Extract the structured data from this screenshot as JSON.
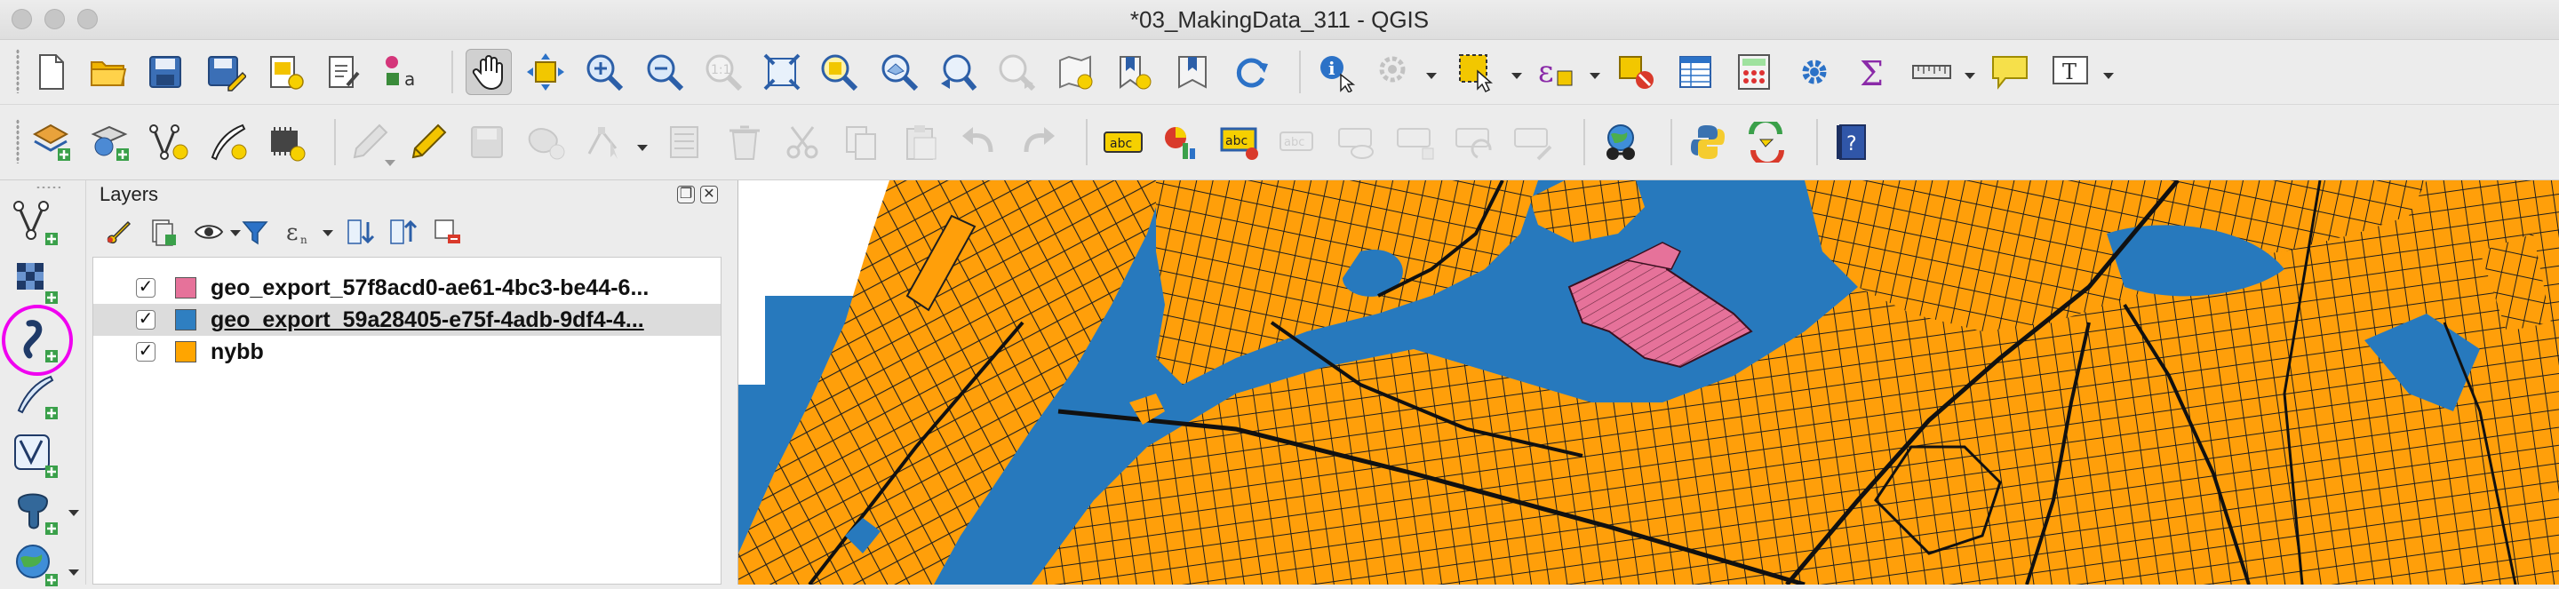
{
  "window": {
    "title": "*03_MakingData_311 - QGIS"
  },
  "toolbar_row1": {
    "icons": [
      "new-project-icon",
      "open-project-icon",
      "save-project-icon",
      "save-as-icon",
      "new-print-layout-icon",
      "layout-manager-icon",
      "style-manager-icon",
      "pan-map-icon",
      "pan-to-selection-icon",
      "zoom-in-icon",
      "zoom-out-icon",
      "zoom-native-icon",
      "zoom-full-icon",
      "zoom-to-selection-icon",
      "zoom-to-layer-icon",
      "zoom-last-icon",
      "zoom-next-icon",
      "new-map-view-icon",
      "new-bookmark-icon",
      "show-bookmarks-icon",
      "refresh-icon",
      "identify-icon",
      "action-icon",
      "select-features-icon",
      "select-by-expression-icon",
      "deselect-icon",
      "attribute-table-icon",
      "field-calculator-icon",
      "processing-toolbox-icon",
      "statistics-icon",
      "measure-icon",
      "map-tips-icon",
      "text-annotation-icon"
    ]
  },
  "toolbar_row2": {
    "icons": [
      "add-layer-icon",
      "data-source-manager-icon",
      "new-shapefile-icon",
      "digitize-icon",
      "plugin-icon",
      "toggle-editing-icon",
      "edit-pencil-icon",
      "save-edits-icon",
      "add-feature-icon",
      "vertex-tool-icon",
      "modify-attributes-icon",
      "delete-selected-icon",
      "cut-features-icon",
      "copy-features-icon",
      "paste-features-icon",
      "undo-icon",
      "redo-icon",
      "label-icon",
      "diagram-icon",
      "highlight-labels-icon",
      "pin-labels-icon",
      "show-hide-labels-icon",
      "move-label-icon",
      "rotate-label-icon",
      "change-label-icon",
      "crs-tool-icon",
      "python-console-icon",
      "plugin-reloader-icon",
      "help-icon"
    ]
  },
  "sidebar": {
    "icons": [
      "new-shapefile-layer-icon",
      "new-raster-layer-icon",
      "new-geopackage-layer-icon",
      "new-spatialite-layer-icon",
      "new-virtual-layer-icon",
      "new-postgis-layer-icon",
      "new-web-layer-icon"
    ]
  },
  "layers_panel": {
    "title": "Layers",
    "layers": [
      {
        "name": "geo_export_57f8acd0-ae61-4bc3-be44-6...",
        "color": "#e6729a",
        "checked": true,
        "selected": false
      },
      {
        "name": "geo_export_59a28405-e75f-4adb-9df4-4...",
        "color": "#2f7fc1",
        "checked": true,
        "selected": true
      },
      {
        "name": "nybb",
        "color": "#ffa500",
        "checked": true,
        "selected": false
      }
    ],
    "check_mark": "✓"
  },
  "colors": {
    "water": "#2779bd",
    "land": "#ff9f0a",
    "parcel": "#e6729a",
    "highlight": "#f000f0"
  }
}
